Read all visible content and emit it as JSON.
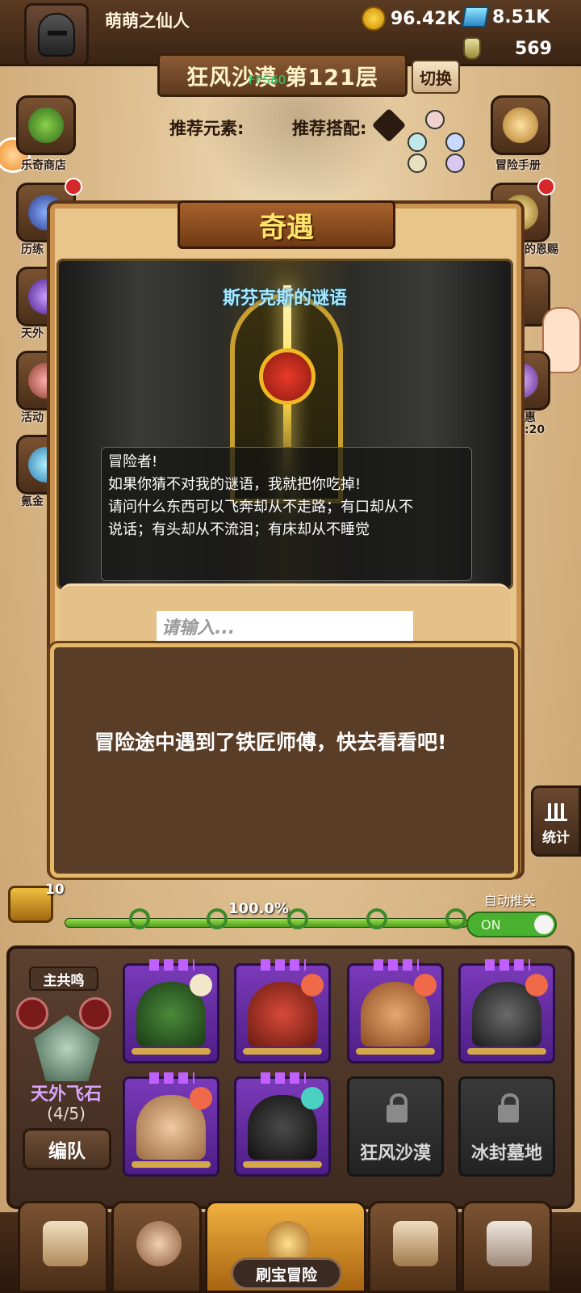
{
  "player": {
    "name": "萌萌之仙人"
  },
  "resources": {
    "gold": "96.42K",
    "gems": "8.51K",
    "potion": "569"
  },
  "stage": {
    "title": "狂风沙漠 第121层",
    "fps": "FPS60",
    "switch_label": "切换",
    "recommended_element_label": "推荐元素:",
    "recommended_combo_label": "推荐搭配:"
  },
  "side_menu": {
    "left": [
      "乐奇商店",
      "历练",
      "天外",
      "活动",
      "氪金"
    ],
    "right": [
      "冒险手册",
      "的恩赐",
      "惠",
      ":20"
    ]
  },
  "dialog": {
    "title": "奇遇",
    "riddle_title": "斯芬克斯的谜语",
    "riddle_lines": [
      "冒险者!",
      "如果你猜不对我的谜语，我就把你吃掉!",
      "请问什么东西可以飞奔却从不走路；有口却从不",
      "说话；有头却从不流泪；有床却从不睡觉"
    ],
    "input_placeholder": "请输入..."
  },
  "toast": {
    "message": "冒险途中遇到了铁匠师傅，快去看看吧!"
  },
  "stats_button": {
    "label": "统计"
  },
  "progress": {
    "chest_count": "10",
    "percent_label": "100.0%",
    "value": 1.0,
    "auto_push_label": "自动推关",
    "auto_push_state": "ON"
  },
  "team": {
    "resonance_label": "主共鸣",
    "set_name": "天外飞石",
    "set_count": "(4/5)",
    "formation_button": "编队",
    "heroes": [
      {
        "name": "green-hood-hero",
        "element": "light"
      },
      {
        "name": "red-demon-hero",
        "element": "fire"
      },
      {
        "name": "turban-hero",
        "element": "fire"
      },
      {
        "name": "pirate-hero",
        "element": "fire"
      },
      {
        "name": "bald-monk-hero",
        "element": "fire"
      },
      {
        "name": "knight-helmet-hero",
        "element": "wind"
      }
    ],
    "locked_slots": [
      "狂风沙漠",
      "冰封墓地"
    ]
  },
  "bottom_nav": {
    "items": [
      "shop",
      "heroes",
      "treasure-adventure",
      "bag",
      "forge"
    ],
    "active_label": "刷宝冒险"
  },
  "colors": {
    "accent_gold": "#ffe46a",
    "riddle_title": "#a8e8ff",
    "set_name": "#d8a6ff",
    "toggle_on": "#4ab030"
  }
}
